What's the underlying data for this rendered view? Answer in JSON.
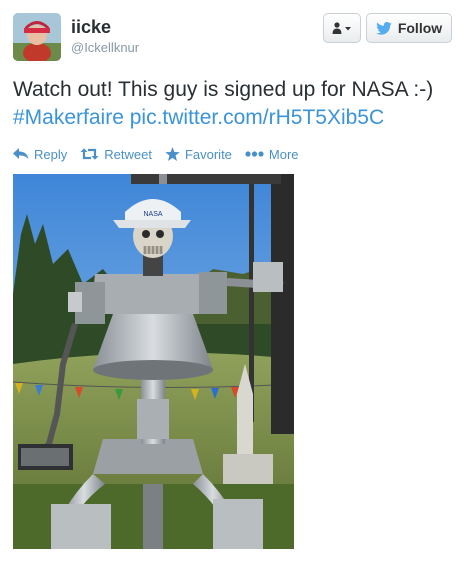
{
  "user": {
    "display_name": "iicke",
    "screen_name": "@Ickellknur"
  },
  "buttons": {
    "follow_label": "Follow"
  },
  "tweet": {
    "text": "Watch out! This guy is signed up for NASA :-)",
    "hashtag": "#Makerfaire",
    "link": "pic.twitter.com/rH5T5Xib5C"
  },
  "actions": {
    "reply": "Reply",
    "retweet": "Retweet",
    "favorite": "Favorite",
    "more": "More"
  },
  "photo": {
    "cap_text": "NASA"
  },
  "colors": {
    "link": "#3b94d9",
    "action": "#4a8fc7",
    "follow_bird": "#55acee"
  }
}
